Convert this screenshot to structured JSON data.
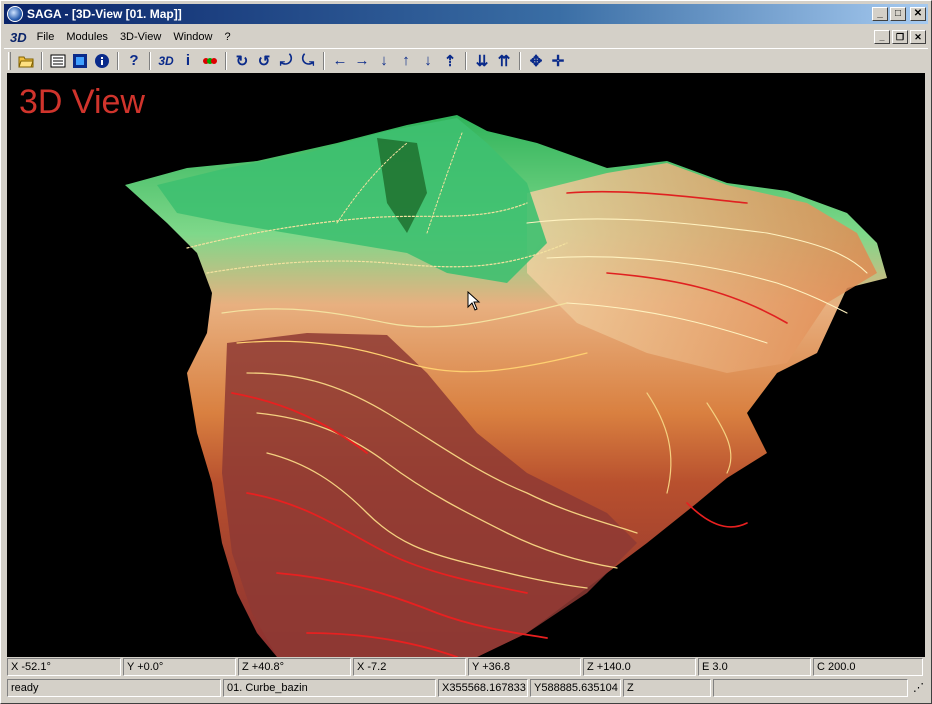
{
  "window": {
    "title": "SAGA - [3D-View [01. Map]]"
  },
  "menu": {
    "doc_icon": "3D",
    "items": [
      "File",
      "Modules",
      "3D-View",
      "Window",
      "?"
    ]
  },
  "toolbar": {
    "icons": [
      "open-folder-icon",
      "list-icon",
      "square-map-icon",
      "info-icon",
      "help-icon",
      "3d-icon",
      "info-i-icon",
      "color-dots-icon",
      "rotate-cw-icon",
      "rotate-ccw-icon",
      "tilt-up-icon",
      "tilt-down-icon",
      "arrow-left-icon",
      "arrow-right-icon",
      "arrow-down-icon",
      "arrow-up-icon",
      "move-down-icon",
      "move-up-icon",
      "exaggerate-down-icon",
      "exaggerate-up-icon",
      "zoom-in-icon",
      "zoom-out-icon"
    ]
  },
  "view": {
    "label": "3D View",
    "label_color": "#d0342c"
  },
  "status_top": [
    "X -52.1°",
    "Y +0.0°",
    "Z +40.8°",
    "X -7.2",
    "Y +36.8",
    "Z +140.0",
    "E 3.0",
    "C 200.0"
  ],
  "status_bottom": [
    "ready",
    "01. Curbe_bazin",
    "X355568.167833",
    "Y588885.635104",
    "Z",
    ""
  ]
}
